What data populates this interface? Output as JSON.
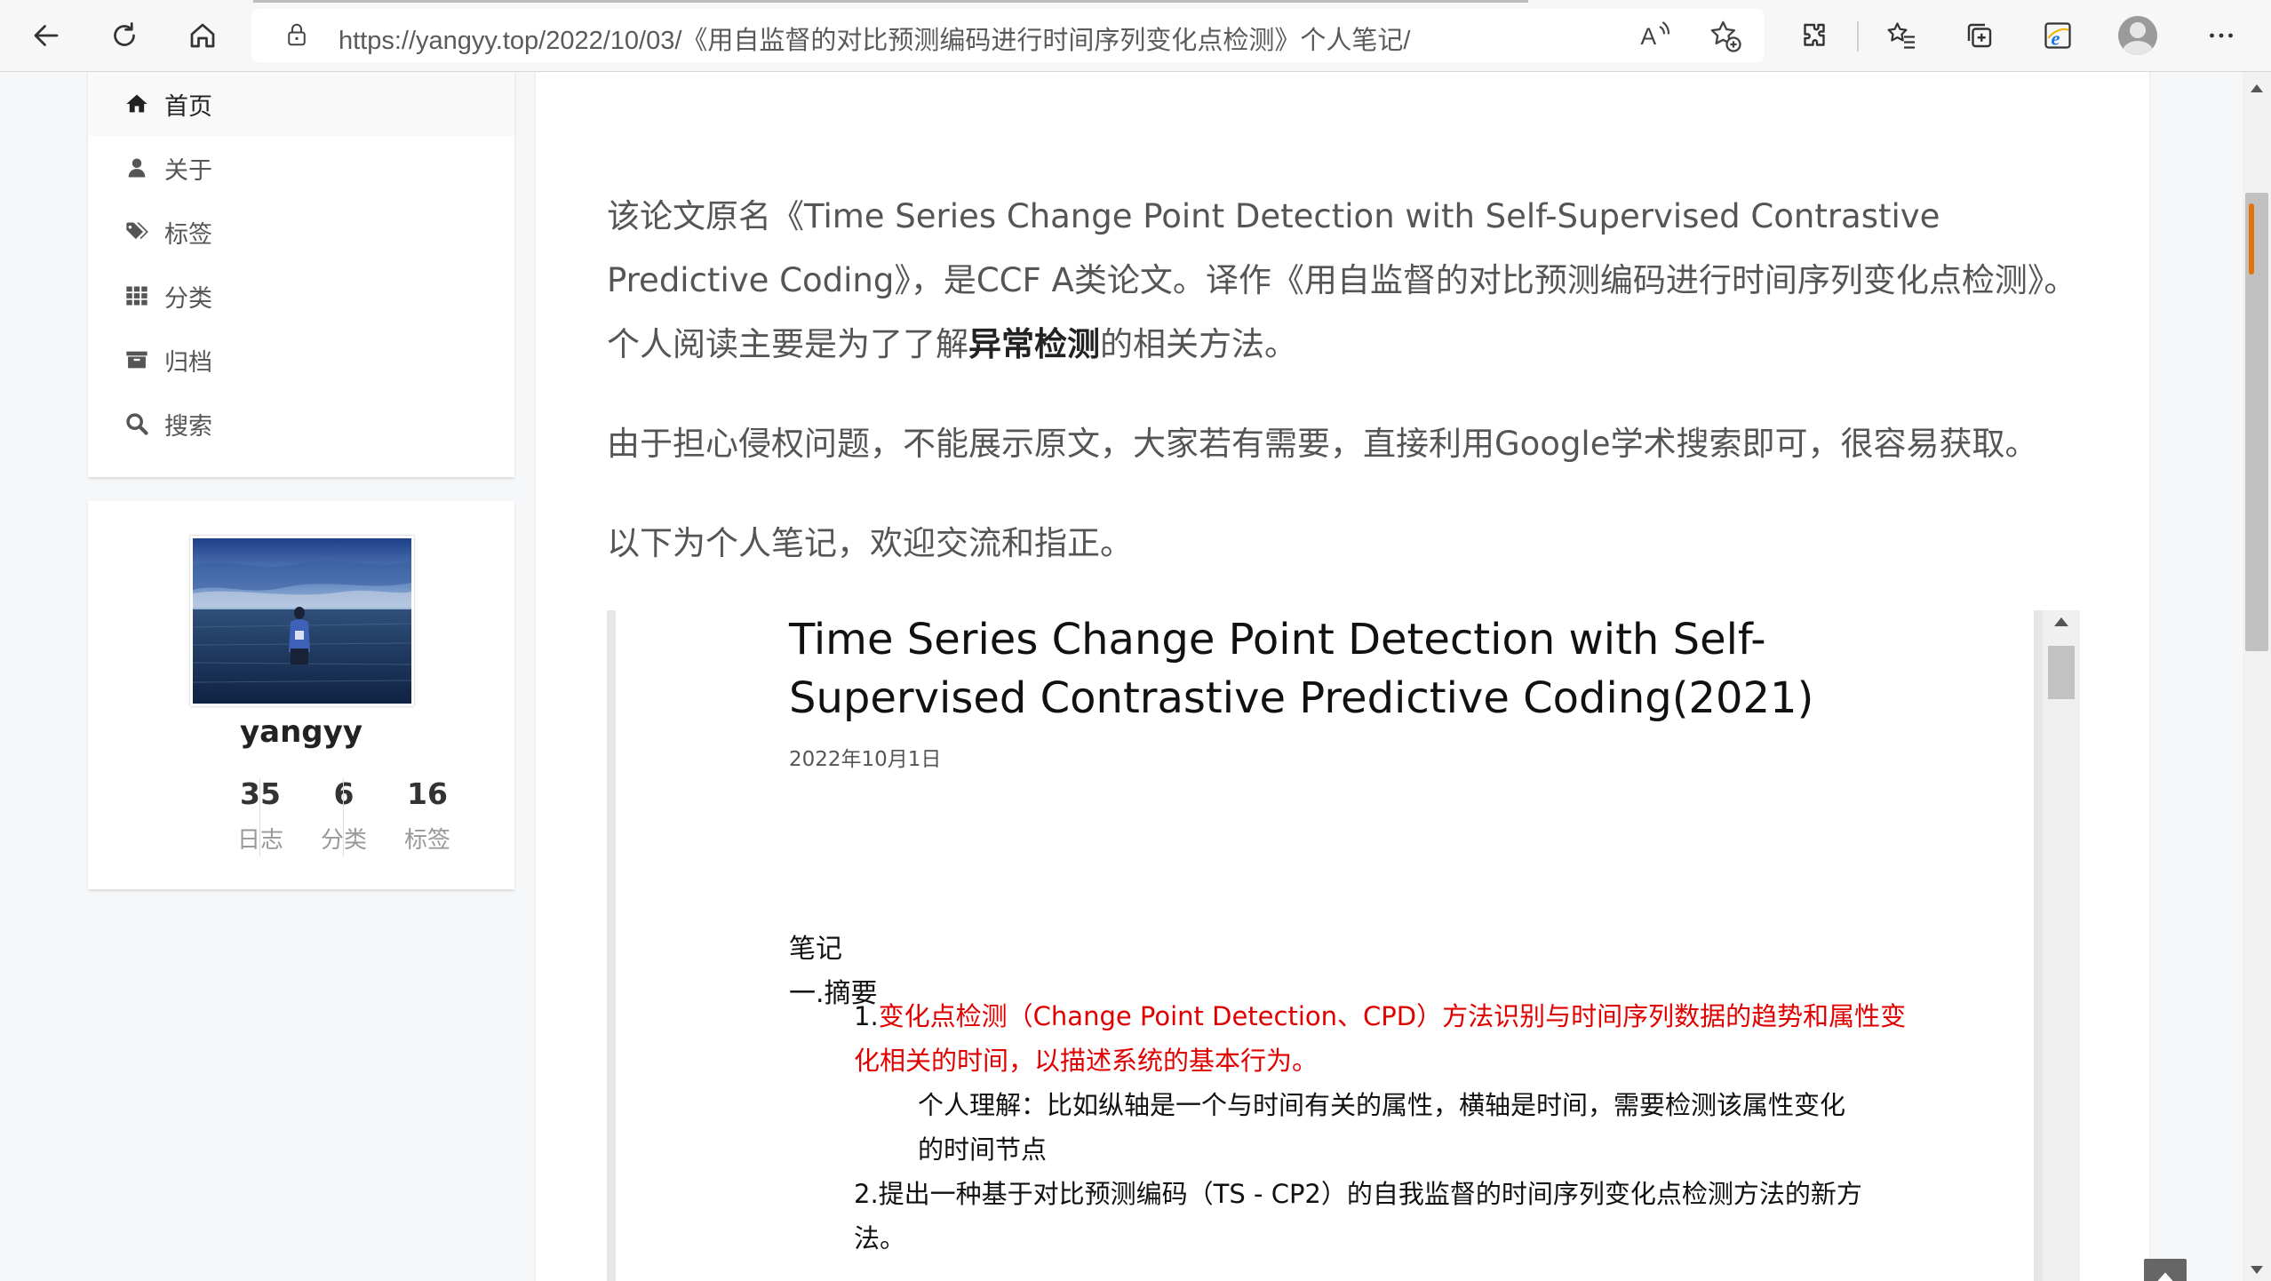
{
  "browser": {
    "url": "https://yangyy.top/2022/10/03/《用自监督的对比预测编码进行时间序列变化点检测》个人笔记/",
    "icons": {
      "back": "back-arrow-icon",
      "refresh": "refresh-icon",
      "home": "home-icon",
      "lock": "lock-icon",
      "read_aloud": "read-aloud-icon",
      "add_favorite": "add-favorite-icon",
      "extensions": "extensions-icon",
      "favorites": "favorites-icon",
      "collections": "collections-icon",
      "ie_mode": "ie-mode-icon",
      "profile": "profile-icon",
      "more": "more-icon"
    }
  },
  "sidebar": {
    "menu": [
      {
        "label": "首页",
        "icon": "home-icon",
        "active": true
      },
      {
        "label": "关于",
        "icon": "user-icon",
        "active": false
      },
      {
        "label": "标签",
        "icon": "tags-icon",
        "active": false
      },
      {
        "label": "分类",
        "icon": "grid-icon",
        "active": false
      },
      {
        "label": "归档",
        "icon": "archive-icon",
        "active": false
      },
      {
        "label": "搜索",
        "icon": "search-icon",
        "active": false
      }
    ],
    "author": {
      "name": "yangyy",
      "stats": [
        {
          "count": "35",
          "label": "日志"
        },
        {
          "count": "6",
          "label": "分类"
        },
        {
          "count": "16",
          "label": "标签"
        }
      ]
    }
  },
  "article": {
    "p1_pre": "该论文原名《Time Series Change Point Detection with Self-Supervised Contrastive Predictive Coding》，是CCF A类论文。译作《用自监督的对比预测编码进行时间序列变化点检测》。个人阅读主要是为了了解",
    "p1_bold": "异常检测",
    "p1_post": "的相关方法。",
    "p2": "由于担心侵权问题，不能展示原文，大家若有需要，直接利用Google学术搜索即可，很容易获取。",
    "p3": "以下为个人笔记，欢迎交流和指正。"
  },
  "pdf": {
    "title": "Time Series Change Point Detection with Self-Supervised Contrastive Predictive Coding(2021)",
    "date": "2022年10月1日",
    "notes_heading": "笔记",
    "abstract_heading": "一.摘要",
    "item1_num": "1.",
    "item1_line1": "变化点检测（Change Point Detection、CPD）方法识别与时间序列数据的趋势和属性变",
    "item1_line2": "化相关的时间，以描述系统的基本行为。",
    "understand_line1": "个人理解：比如纵轴是一个与时间有关的属性，横轴是时间，需要检测该属性变化",
    "understand_line2": "的时间节点",
    "item2_line1": "2.提出一种基于对比预测编码（TS - CP2）的自我监督的时间序列变化点检测方法的新方",
    "item2_line2": "法。"
  },
  "colors": {
    "accent_red": "#e00000",
    "page_bg": "#f5f7f9",
    "scroll_marker": "#e0730c"
  }
}
